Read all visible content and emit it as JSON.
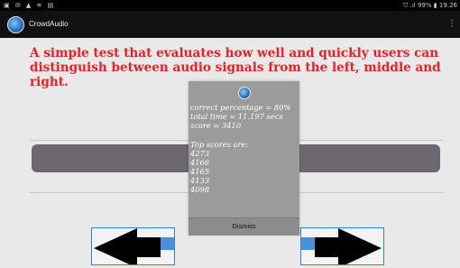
{
  "status_bar": {
    "left_icons": "▣ ✉ ▲ ≋ ▤",
    "right_text": "⛉ .ıl 99% ▮ 19:26"
  },
  "app": {
    "title": "CrowdAudio",
    "overflow_icon": "⋮"
  },
  "main": {
    "description": "A simple test that evaluates how well and quickly users can distinguish between audio signals from the left, middle and right."
  },
  "dialog": {
    "correct_percentage": "correct percentage = 80%",
    "total_time": "total time = 11.197 secs",
    "score": "score = 3410",
    "top_scores_heading": "Top scores are:",
    "top_scores": [
      "4273",
      "4166",
      "4165",
      "4133",
      "4098"
    ],
    "dismiss_label": "Dismiss"
  },
  "colors": {
    "description_text": "#e0242a",
    "progress_bar": "#6d6770",
    "arrow_blue": "#4a8fd8",
    "dialog_bg": "#9b9b9b"
  },
  "icons": {
    "app_icon": "globe-icon",
    "left_arrow": "left-arrow-icon",
    "right_arrow": "right-arrow-icon",
    "overflow": "overflow-menu-icon"
  }
}
